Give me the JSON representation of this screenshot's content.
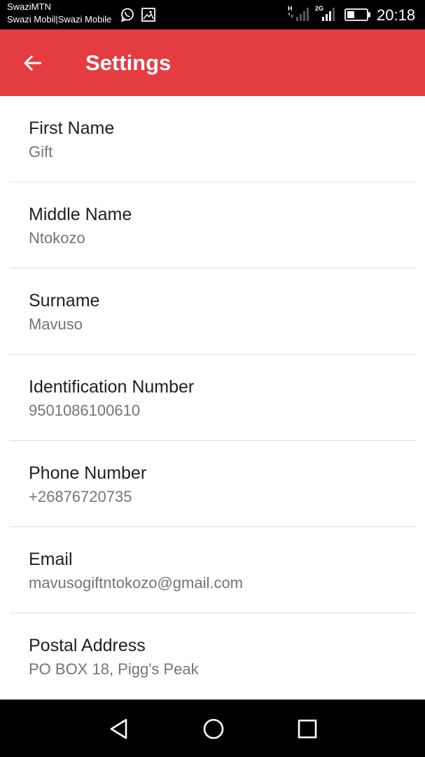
{
  "status_bar": {
    "carrier_primary": "SwaziMTN",
    "carrier_secondary": "Swazi Mobil|Swazi Mobile",
    "network_1": "H",
    "network_2": "2G",
    "time": "20:18",
    "icons": [
      "whatsapp-icon",
      "gallery-icon",
      "signal-icon",
      "battery-icon"
    ]
  },
  "app_bar": {
    "title": "Settings",
    "back_icon": "arrow-left-icon",
    "color": "#e43c41"
  },
  "settings": [
    {
      "label": "First Name",
      "value": "Gift"
    },
    {
      "label": "Middle Name",
      "value": "Ntokozo"
    },
    {
      "label": "Surname",
      "value": "Mavuso"
    },
    {
      "label": "Identification Number",
      "value": "9501086100610"
    },
    {
      "label": "Phone Number",
      "value": "+26876720735"
    },
    {
      "label": "Email",
      "value": "mavusogiftntokozo@gmail.com"
    },
    {
      "label": "Postal Address",
      "value": "PO BOX 18, Pigg's Peak"
    }
  ],
  "nav_bar": {
    "icons": [
      "back-triangle-icon",
      "home-circle-icon",
      "recents-square-icon"
    ]
  }
}
